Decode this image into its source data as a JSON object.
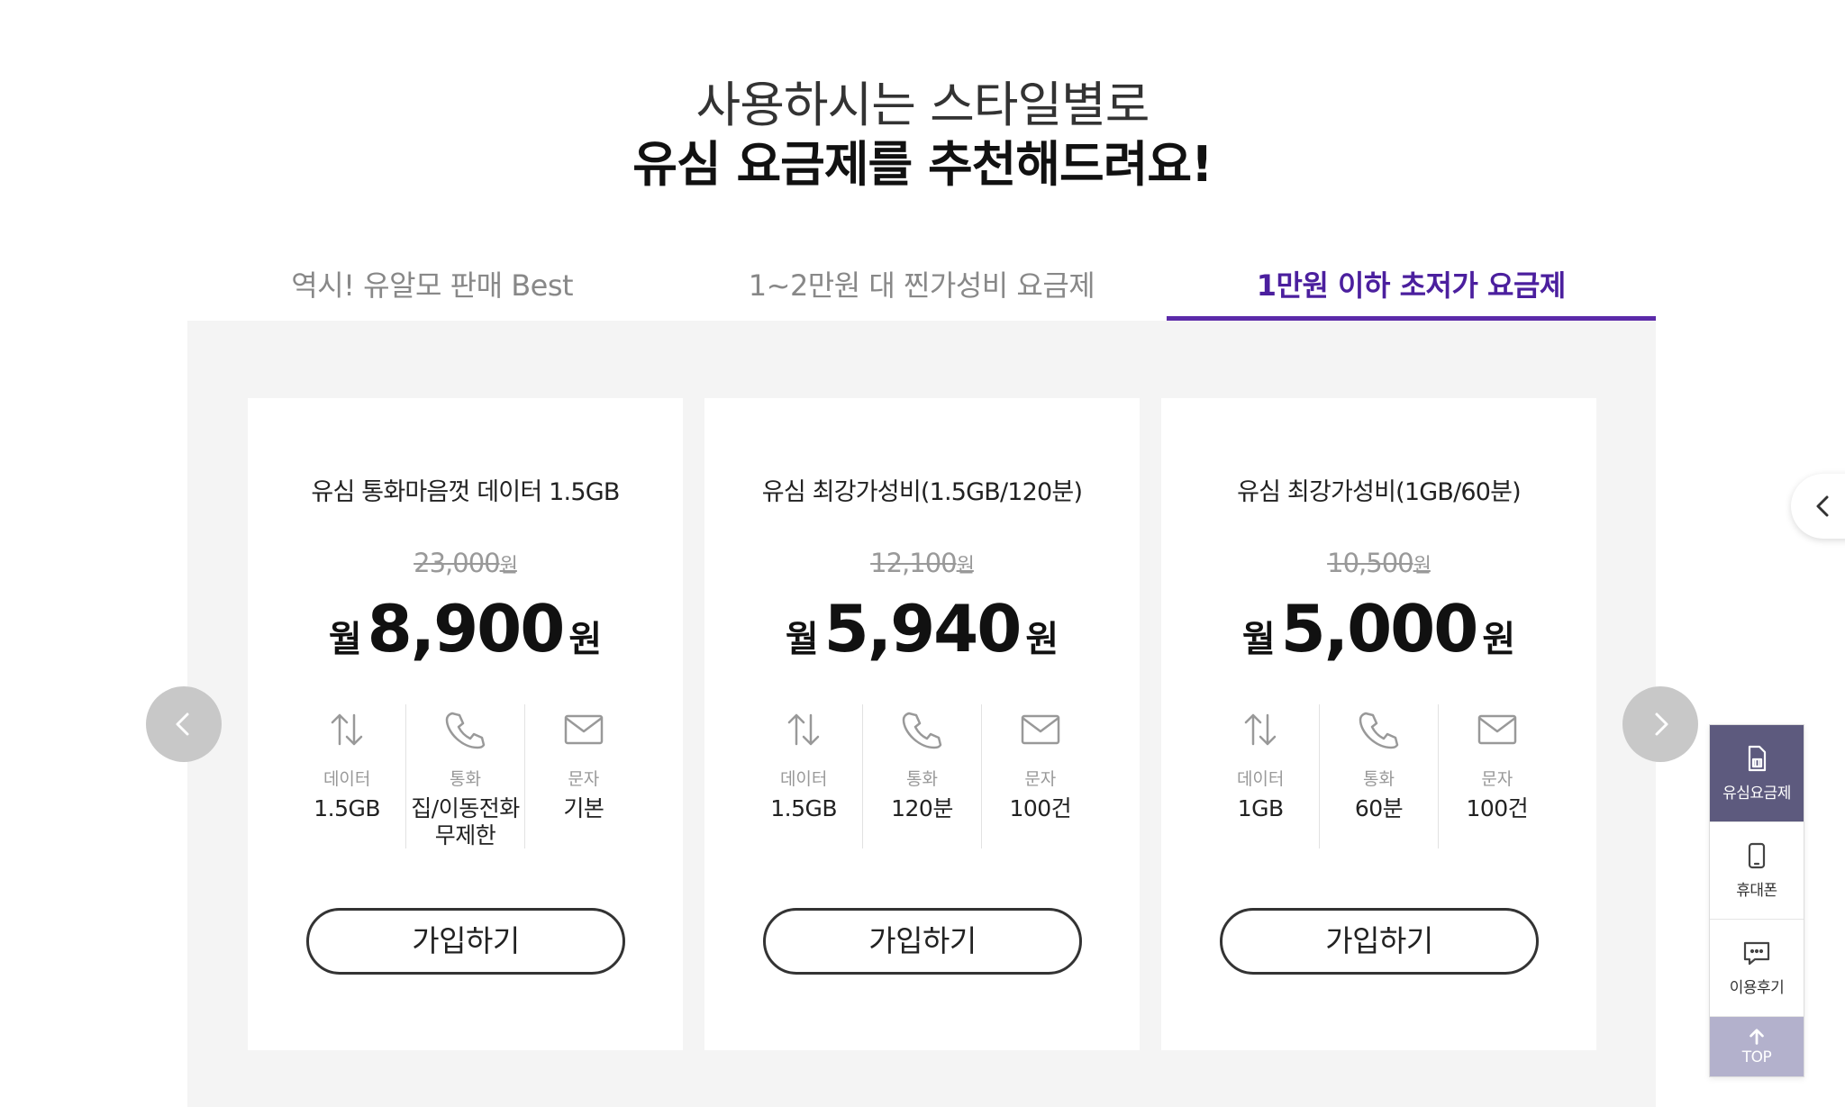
{
  "heading": {
    "line1": "사용하시는 스타일별로",
    "line2": "유심 요금제를 추천해드려요!"
  },
  "tabs": [
    {
      "label": "역시! 유알모 판매 Best",
      "active": false
    },
    {
      "label": "1~2만원 대 찐가성비 요금제",
      "active": false
    },
    {
      "label": "1만원 이하 초저가 요금제",
      "active": true
    }
  ],
  "accent_color": "#5b2aa9",
  "cards": [
    {
      "name": "유심 통화마음껏 데이터 1.5GB",
      "original_price": "23,000",
      "original_unit": "원",
      "price_prefix": "월",
      "price": "8,900",
      "price_unit": "원",
      "specs": [
        {
          "icon": "data-arrows-icon",
          "label": "데이터",
          "value": "1.5GB"
        },
        {
          "icon": "phone-icon",
          "label": "통화",
          "value": "집/이동전화 무제한"
        },
        {
          "icon": "mail-icon",
          "label": "문자",
          "value": "기본"
        }
      ],
      "button": "가입하기"
    },
    {
      "name": "유심 최강가성비(1.5GB/120분)",
      "original_price": "12,100",
      "original_unit": "원",
      "price_prefix": "월",
      "price": "5,940",
      "price_unit": "원",
      "specs": [
        {
          "icon": "data-arrows-icon",
          "label": "데이터",
          "value": "1.5GB"
        },
        {
          "icon": "phone-icon",
          "label": "통화",
          "value": "120분"
        },
        {
          "icon": "mail-icon",
          "label": "문자",
          "value": "100건"
        }
      ],
      "button": "가입하기"
    },
    {
      "name": "유심 최강가성비(1GB/60분)",
      "original_price": "10,500",
      "original_unit": "원",
      "price_prefix": "월",
      "price": "5,000",
      "price_unit": "원",
      "specs": [
        {
          "icon": "data-arrows-icon",
          "label": "데이터",
          "value": "1GB"
        },
        {
          "icon": "phone-icon",
          "label": "통화",
          "value": "60분"
        },
        {
          "icon": "mail-icon",
          "label": "문자",
          "value": "100건"
        }
      ],
      "button": "가입하기"
    }
  ],
  "quick_menu": [
    {
      "icon": "sim-card-icon",
      "label": "유심요금제",
      "active": true
    },
    {
      "icon": "mobile-phone-icon",
      "label": "휴대폰",
      "active": false
    },
    {
      "icon": "review-chat-icon",
      "label": "이용후기",
      "active": false
    }
  ],
  "top_button": "TOP"
}
